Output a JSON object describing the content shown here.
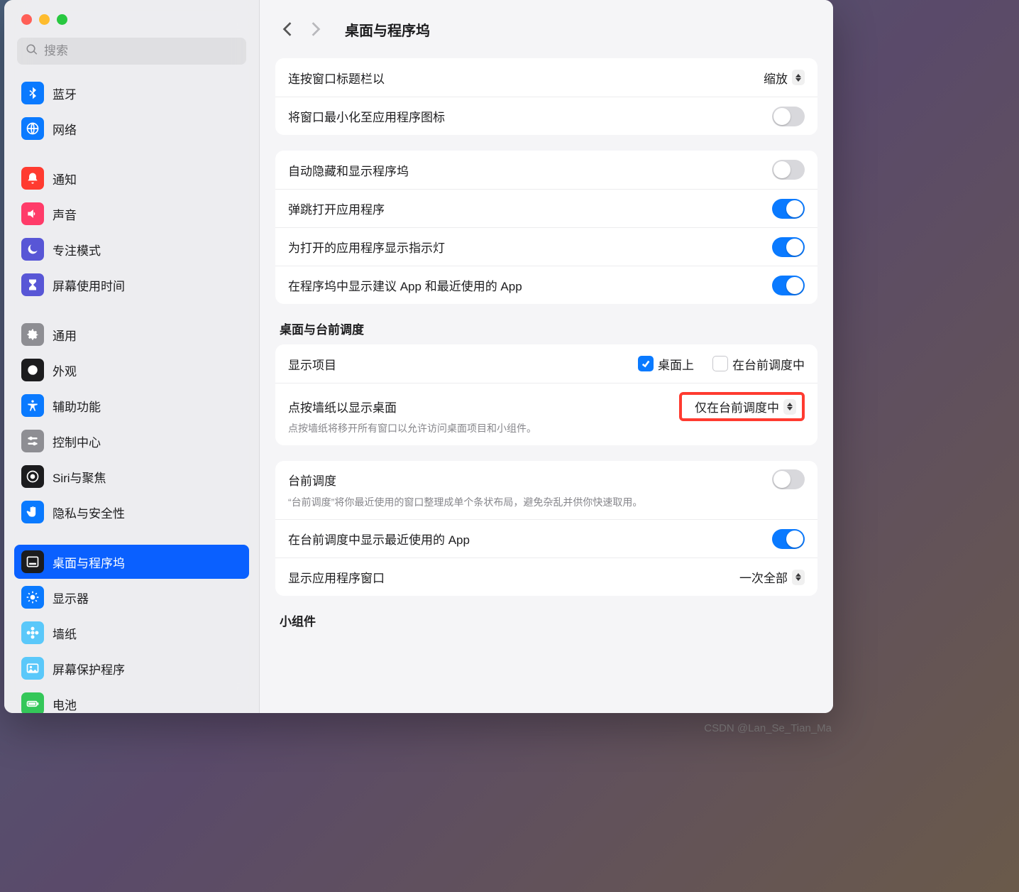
{
  "header": {
    "title": "桌面与程序坞"
  },
  "search": {
    "placeholder": "搜索"
  },
  "sidebar": {
    "items": [
      {
        "label": "蓝牙",
        "icon": "bluetooth-icon",
        "bg": "#0a7aff"
      },
      {
        "label": "网络",
        "icon": "globe-icon",
        "bg": "#0a7aff"
      },
      {
        "gap": true
      },
      {
        "label": "通知",
        "icon": "bell-icon",
        "bg": "#ff3b30"
      },
      {
        "label": "声音",
        "icon": "speaker-icon",
        "bg": "#ff3b69"
      },
      {
        "label": "专注模式",
        "icon": "moon-icon",
        "bg": "#5856d6"
      },
      {
        "label": "屏幕使用时间",
        "icon": "hourglass-icon",
        "bg": "#5856d6"
      },
      {
        "gap": true
      },
      {
        "label": "通用",
        "icon": "gear-icon",
        "bg": "#8e8e93"
      },
      {
        "label": "外观",
        "icon": "appearance-icon",
        "bg": "#1c1c1e"
      },
      {
        "label": "辅助功能",
        "icon": "accessibility-icon",
        "bg": "#0a7aff"
      },
      {
        "label": "控制中心",
        "icon": "sliders-icon",
        "bg": "#8e8e93"
      },
      {
        "label": "Siri与聚焦",
        "icon": "siri-icon",
        "bg": "#1c1c1e"
      },
      {
        "label": "隐私与安全性",
        "icon": "hand-icon",
        "bg": "#0a7aff"
      },
      {
        "gap": true
      },
      {
        "label": "桌面与程序坞",
        "icon": "dock-icon",
        "bg": "#1c1c1e",
        "selected": true
      },
      {
        "label": "显示器",
        "icon": "sun-icon",
        "bg": "#0a7aff"
      },
      {
        "label": "墙纸",
        "icon": "flower-icon",
        "bg": "#5ac8fa"
      },
      {
        "label": "屏幕保护程序",
        "icon": "photo-icon",
        "bg": "#5ac8fa"
      },
      {
        "label": "电池",
        "icon": "battery-icon",
        "bg": "#34c759"
      }
    ]
  },
  "group1": {
    "r0": {
      "label": "连按窗口标题栏以",
      "value": "缩放"
    },
    "r1": {
      "label": "将窗口最小化至应用程序图标",
      "on": false
    }
  },
  "group2": {
    "r0": {
      "label": "自动隐藏和显示程序坞",
      "on": false
    },
    "r1": {
      "label": "弹跳打开应用程序",
      "on": true
    },
    "r2": {
      "label": "为打开的应用程序显示指示灯",
      "on": true
    },
    "r3": {
      "label": "在程序坞中显示建议 App 和最近使用的 App",
      "on": true
    }
  },
  "stage": {
    "section_title": "桌面与台前调度",
    "show_items_label": "显示项目",
    "cb_desktop": {
      "label": "桌面上",
      "checked": true
    },
    "cb_stage": {
      "label": "在台前调度中",
      "checked": false
    },
    "click_wall": {
      "label": "点按墙纸以显示桌面",
      "sub": "点按墙纸将移开所有窗口以允许访问桌面项目和小组件。",
      "value": "仅在台前调度中"
    }
  },
  "group3": {
    "stage_mgr": {
      "label": "台前调度",
      "sub": "“台前调度”将你最近使用的窗口整理成单个条状布局，避免杂乱并供你快速取用。",
      "on": false
    },
    "recent": {
      "label": "在台前调度中显示最近使用的 App",
      "on": true
    },
    "show_win": {
      "label": "显示应用程序窗口",
      "value": "一次全部"
    }
  },
  "widgets": {
    "section_title": "小组件"
  },
  "watermark": "CSDN @Lan_Se_Tian_Ma"
}
